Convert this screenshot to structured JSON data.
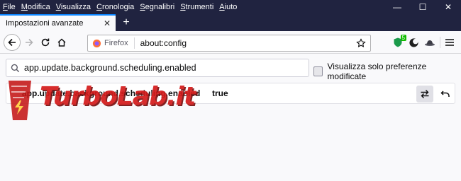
{
  "menu": {
    "items": [
      {
        "underline": "F",
        "rest": "ile"
      },
      {
        "underline": "M",
        "rest": "odifica"
      },
      {
        "underline": "V",
        "rest": "isualizza"
      },
      {
        "underline": "C",
        "rest": "ronologia"
      },
      {
        "underline": "S",
        "rest": "egnalibri"
      },
      {
        "underline": "S",
        "rest": "trumenti"
      },
      {
        "underline": "A",
        "rest": "iuto"
      }
    ]
  },
  "window_controls": {
    "minimize": "—",
    "maximize": "☐",
    "close": "✕"
  },
  "tab": {
    "title": "Impostazioni avanzate",
    "close": "✕",
    "new_tab": "+"
  },
  "urlbar": {
    "identity_label": "Firefox",
    "url": "about:config"
  },
  "extensions": {
    "badge_count": "5"
  },
  "search": {
    "value": "app.update.background.scheduling.enabled"
  },
  "modified_filter": {
    "label": "Visualizza solo preferenze modificate",
    "checked": false
  },
  "preference": {
    "name": "app.update.background.scheduling.enabled",
    "value": "true"
  },
  "watermark": {
    "text": "TurboLab.it"
  },
  "colors": {
    "titlebar": "#202340",
    "accent": "#0a84ff",
    "watermark": "#d41b1b"
  }
}
